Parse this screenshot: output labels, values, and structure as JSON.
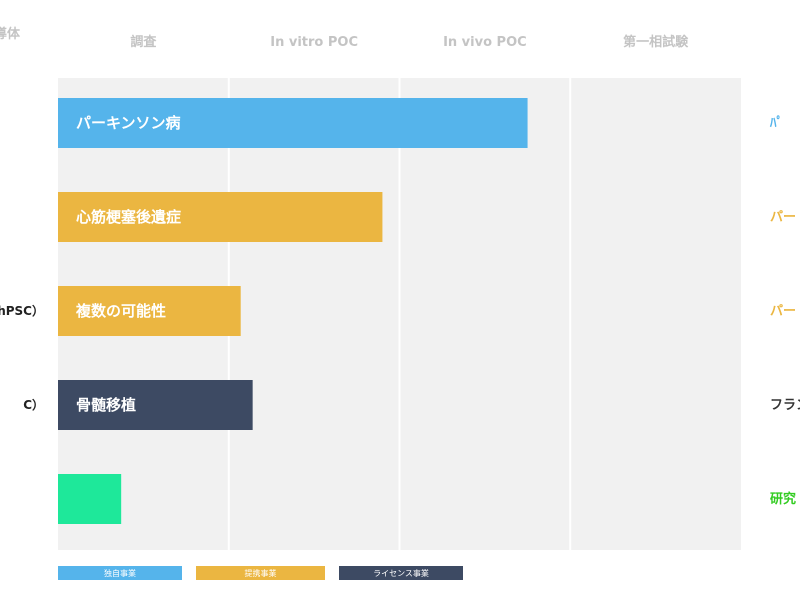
{
  "chart_data": {
    "type": "bar",
    "orientation": "horizontal",
    "header_left_partial": "導体",
    "stages": [
      "調査",
      "In vitro POC",
      "In vivo POC",
      "第一相試験"
    ],
    "x_unit": "stage",
    "xlim": [
      0,
      4
    ],
    "grid": true,
    "bars": [
      {
        "label": "パーキンソン病",
        "value": 2.75,
        "color": "#55b4eb",
        "left_label": "",
        "right_label": "ﾊﾟ",
        "right_color": "#55b4eb"
      },
      {
        "label": "心筋梗塞後遺症",
        "value": 1.9,
        "color": "#ebb641",
        "left_label": "",
        "right_label": "パー",
        "right_color": "#ebb641"
      },
      {
        "label": "複数の可能性",
        "value": 1.07,
        "color": "#ebb641",
        "left_label": "（hPSC）",
        "right_label": "パー",
        "right_color": "#ebb641"
      },
      {
        "label": "骨髄移植",
        "value": 1.14,
        "color": "#3d4a63",
        "left_label": "C）",
        "right_label": "フランス",
        "right_color": "#333333"
      },
      {
        "label": "",
        "value": 0.37,
        "color": "#1ee89a",
        "left_label": "",
        "right_label": "研究",
        "right_color": "#33cc22"
      }
    ],
    "legend": [
      {
        "name": "独自事業",
        "color": "#55b4eb"
      },
      {
        "name": "提携事業",
        "color": "#ebb641"
      },
      {
        "name": "ライセンス事業",
        "color": "#3d4a63"
      }
    ],
    "legend_position": "bottom"
  }
}
